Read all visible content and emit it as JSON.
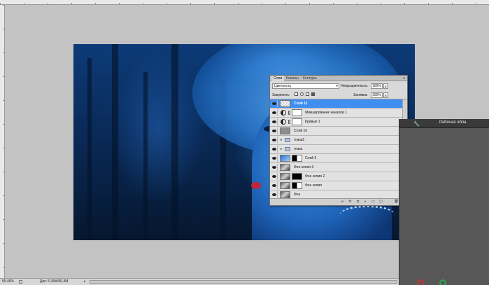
{
  "layers_panel": {
    "tabs": [
      {
        "label": "Слои"
      },
      {
        "label": "Каналы"
      },
      {
        "label": "Контуры"
      }
    ],
    "menu_icon": "≡",
    "blend_mode": {
      "value": "Цветность",
      "arrow": "▾"
    },
    "opacity": {
      "label": "Непрозрачность:",
      "value": "100%",
      "stepper": "▸"
    },
    "lock_label": "Закрепить:",
    "fill": {
      "label": "Заливка:",
      "value": "100%",
      "stepper": "▸"
    },
    "layers": [
      {
        "name": "Слой 11",
        "thumb": "checker",
        "selected": true
      },
      {
        "name": "Микширование каналов 1",
        "thumb": "adjustment",
        "selected": false
      },
      {
        "name": "Кривые 1",
        "thumb": "adjustment",
        "selected": false
      },
      {
        "name": "Слой 10",
        "thumb": "gray",
        "selected": false
      },
      {
        "name": "глаза2",
        "thumb": "folder",
        "selected": false
      },
      {
        "name": "глаза",
        "thumb": "folder",
        "selected": false
      },
      {
        "name": "Слой 2",
        "thumb": "blue",
        "selected": false
      },
      {
        "name": "Фон копия 3",
        "thumb": "photo",
        "selected": false
      },
      {
        "name": "Фон копия 2",
        "thumb": "photo-mask",
        "selected": false
      },
      {
        "name": "Фон копия",
        "thumb": "photo-mask",
        "selected": false
      },
      {
        "name": "Фон",
        "thumb": "photo",
        "selected": false
      }
    ],
    "expand_arrow": "▸",
    "footer_icons": [
      "∞",
      "fx",
      "◘",
      "◐",
      "▭",
      "▢",
      "🗑"
    ]
  },
  "right_panel": {
    "title": "Рабочая обла",
    "wrench_glyph": "🔧"
  },
  "status_bar": {
    "zoom": "55.46%",
    "doc": "Док: 5,34M/66,4M",
    "arrow": "▸"
  }
}
